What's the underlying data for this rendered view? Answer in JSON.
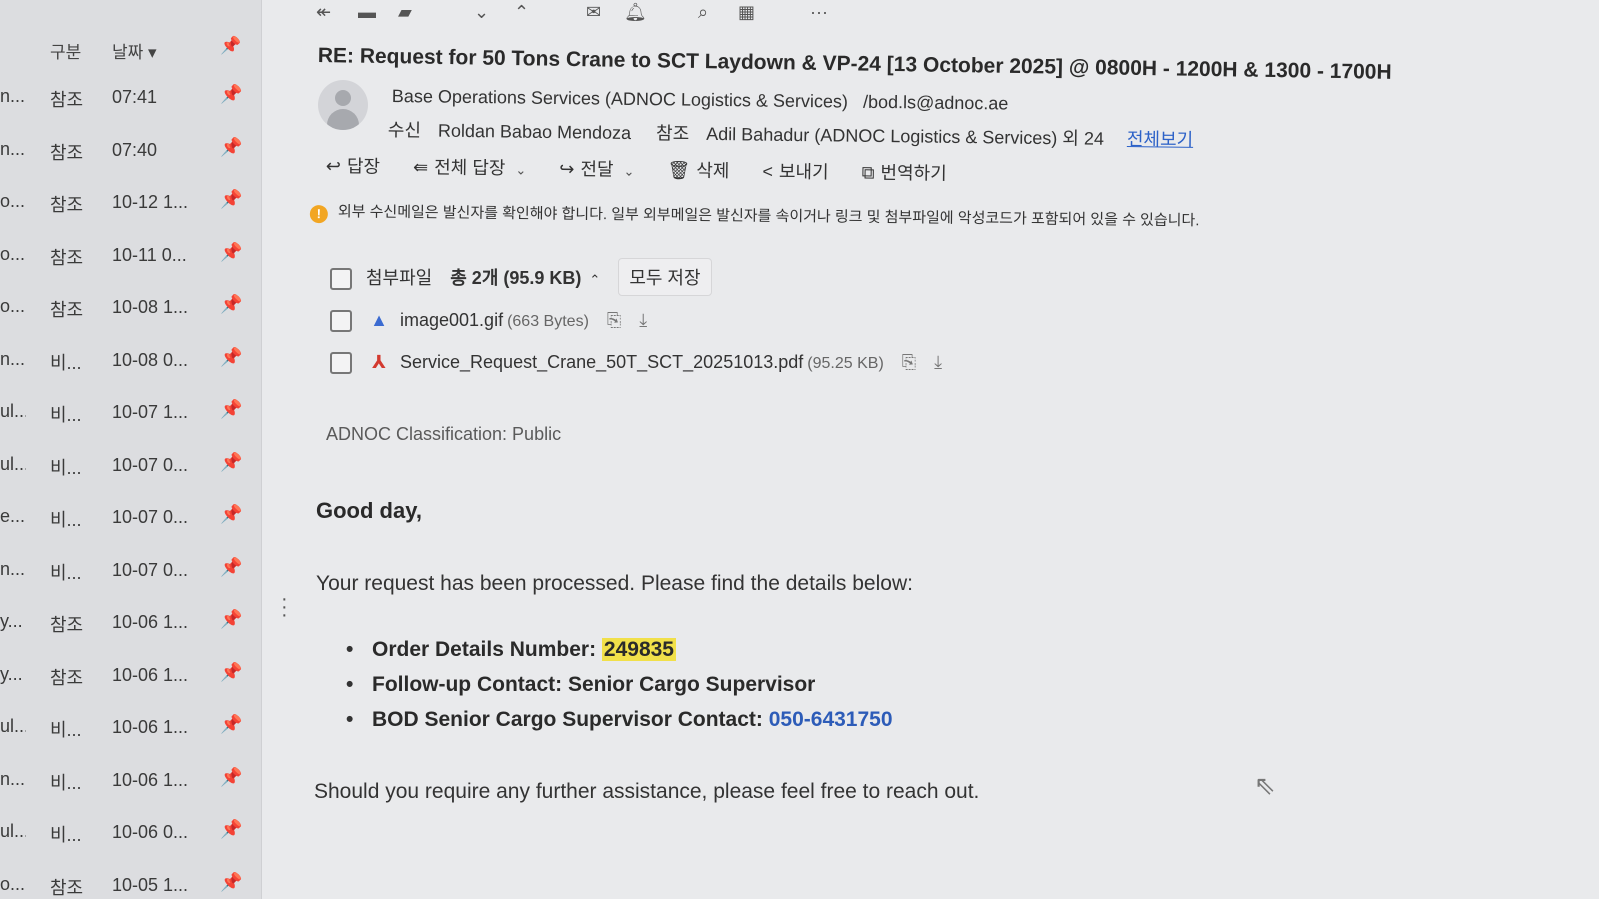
{
  "toolbar_icons": [
    "reply-back-icon",
    "note-icon",
    "move-icon",
    "chevron-down-icon",
    "chevron-up-icon",
    "envelope-icon",
    "bell-icon",
    "zoom-icon",
    "calendar-icon",
    "more-icon"
  ],
  "list": {
    "header": {
      "type": "구분",
      "date": "날짜 ▾"
    },
    "rows": [
      {
        "sender": "n...",
        "type": "참조",
        "date": "07:41"
      },
      {
        "sender": "n...",
        "type": "참조",
        "date": "07:40"
      },
      {
        "sender": "o...",
        "type": "참조",
        "date": "10-12 1..."
      },
      {
        "sender": "o...",
        "type": "참조",
        "date": "10-11 0..."
      },
      {
        "sender": "o...",
        "type": "참조",
        "date": "10-08 1..."
      },
      {
        "sender": "n...",
        "type": "비...",
        "date": "10-08 0..."
      },
      {
        "sender": "ul...",
        "type": "비...",
        "date": "10-07 1..."
      },
      {
        "sender": "ul...",
        "type": "비...",
        "date": "10-07 0..."
      },
      {
        "sender": "e...",
        "type": "비...",
        "date": "10-07 0..."
      },
      {
        "sender": "n...",
        "type": "비...",
        "date": "10-07 0..."
      },
      {
        "sender": "y...",
        "type": "참조",
        "date": "10-06 1..."
      },
      {
        "sender": "y...",
        "type": "참조",
        "date": "10-06 1..."
      },
      {
        "sender": "ul...",
        "type": "비...",
        "date": "10-06 1..."
      },
      {
        "sender": "n...",
        "type": "비...",
        "date": "10-06 1..."
      },
      {
        "sender": "ul...",
        "type": "비...",
        "date": "10-06 0..."
      },
      {
        "sender": "o...",
        "type": "참조",
        "date": "10-05 1..."
      }
    ]
  },
  "mail": {
    "subject": "RE: Request for 50 Tons Crane to SCT Laydown & VP-24 [13 October 2025] @ 0800H - 1200H & 1300 - 1700H",
    "from_name": "Base Operations Services (ADNOC Logistics & Services)",
    "from_email": "/bod.ls@adnoc.ae",
    "to_label": "수신",
    "to_name": "Roldan Babao Mendoza",
    "cc_label": "참조",
    "cc_name": "Adil Bahadur (ADNOC Logistics & Services) 외 24",
    "view_all": "전체보기",
    "actions": {
      "reply": "답장",
      "reply_all": "전체 답장",
      "forward": "전달",
      "delete": "삭제",
      "share": "보내기",
      "translate": "번역하기"
    },
    "warning": "외부 수신메일은 발신자를 확인해야 합니다. 일부 외부메일은 발신자를 속이거나 링크 및 첨부파일에 악성코드가 포함되어 있을 수 있습니다.",
    "attachments": {
      "label": "첨부파일",
      "total": "총 2개  (95.9 KB)",
      "save_all": "모두 저장",
      "files": [
        {
          "name": "image001.gif",
          "size": "(663 Bytes)"
        },
        {
          "name": "Service_Request_Crane_50T_SCT_20251013.pdf",
          "size": "(95.25 KB)"
        }
      ]
    },
    "classification": "ADNOC Classification: Public",
    "greeting": "Good day,",
    "intro": "Your request has been processed. Please find the details below:",
    "details": {
      "order_label": "Order Details Number: ",
      "order_number": "249835",
      "followup": "Follow-up Contact: Senior Cargo Supervisor",
      "bod_label": "BOD Senior Cargo Supervisor Contact: ",
      "bod_phone": "050-6431750"
    },
    "closing": "Should you require any further assistance, please feel free to reach out."
  }
}
